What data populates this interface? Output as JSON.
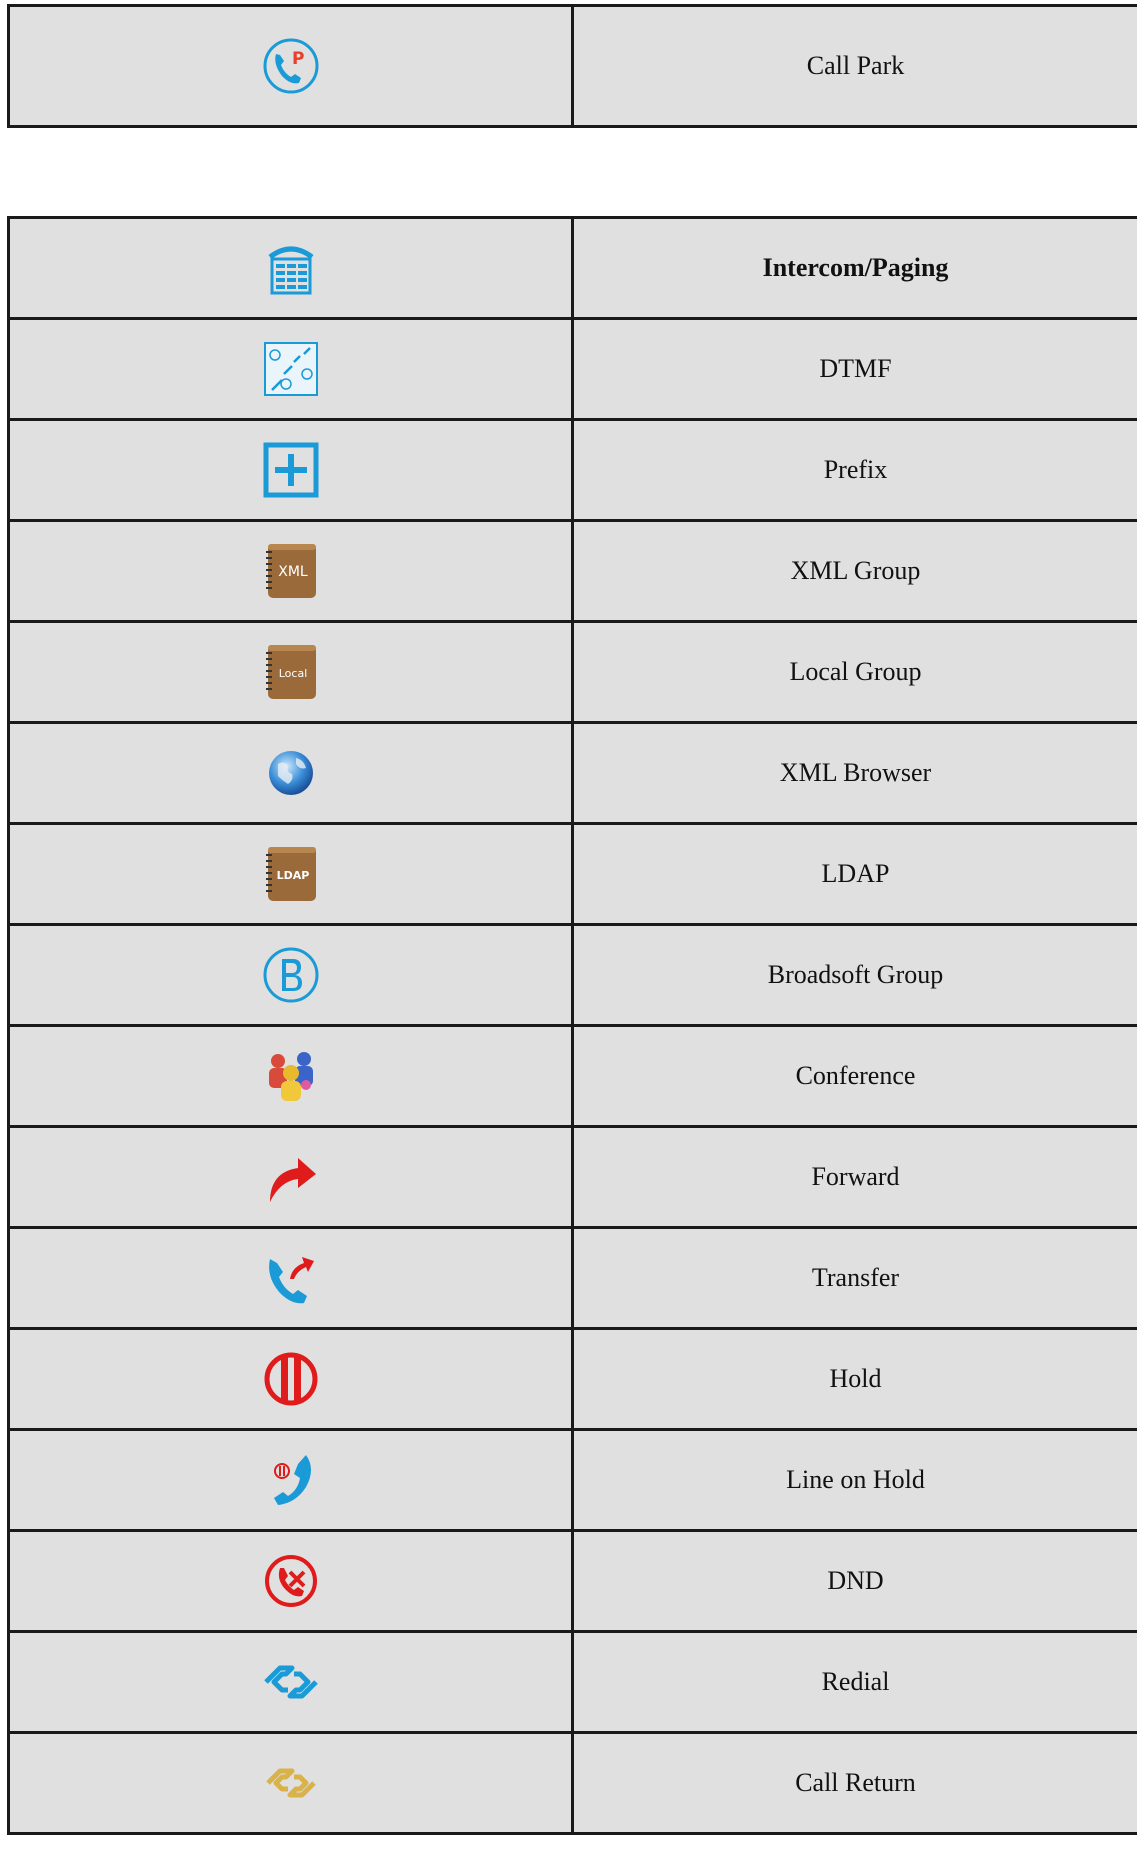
{
  "table_top": {
    "rows": [
      {
        "icon": "call-park-icon",
        "label": "Call Park"
      }
    ]
  },
  "table_main": {
    "rows": [
      {
        "icon": "intercom-paging-icon",
        "label": "Intercom/Paging",
        "bold": true
      },
      {
        "icon": "dtmf-icon",
        "label": "DTMF"
      },
      {
        "icon": "prefix-icon",
        "label": "Prefix"
      },
      {
        "icon": "xml-group-icon",
        "label": "XML Group",
        "book_text": "XML"
      },
      {
        "icon": "local-group-icon",
        "label": "Local Group",
        "book_text": "Local"
      },
      {
        "icon": "xml-browser-icon",
        "label": "XML Browser"
      },
      {
        "icon": "ldap-icon",
        "label": "LDAP",
        "book_text": "LDAP"
      },
      {
        "icon": "broadsoft-group-icon",
        "label": "Broadsoft Group"
      },
      {
        "icon": "conference-icon",
        "label": "Conference"
      },
      {
        "icon": "forward-icon",
        "label": "Forward"
      },
      {
        "icon": "transfer-icon",
        "label": "Transfer"
      },
      {
        "icon": "hold-icon",
        "label": "Hold"
      },
      {
        "icon": "line-on-hold-icon",
        "label": "Line on Hold"
      },
      {
        "icon": "dnd-icon",
        "label": "DND"
      },
      {
        "icon": "redial-icon",
        "label": "Redial"
      },
      {
        "icon": "call-return-icon",
        "label": "Call Return"
      }
    ]
  },
  "colors": {
    "blue": "#1a9ad6",
    "red": "#e01b1b",
    "brown": "#9a6a3a",
    "gold": "#d9b24a",
    "cell_bg": "#e0e0e0",
    "border": "#1a1a1a"
  }
}
